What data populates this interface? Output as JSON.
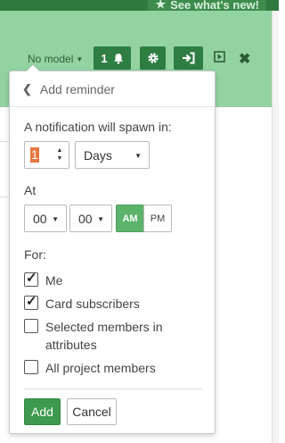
{
  "top_bar": {
    "whats_new_label": "See what's new!",
    "whats_new_icon": "star-icon"
  },
  "header": {
    "model_select_label": "No model",
    "notification_count": "1",
    "bell_icon": "bell-icon",
    "gear_icon": "gear-icon",
    "login_icon": "login-icon",
    "play_icon": "play-icon",
    "close_icon": "close-icon",
    "colors": {
      "header_bg": "#93d3a2",
      "button_bg": "#2e7d42",
      "accent": "#3d9a4e"
    }
  },
  "popup": {
    "title": "Add reminder",
    "spawn_label": "A notification will spawn in:",
    "amount_value": "1",
    "unit_value": "Days",
    "at_label": "At",
    "hour_value": "00",
    "minute_value": "00",
    "am_label": "AM",
    "pm_label": "PM",
    "selected_period": "AM",
    "for_label": "For:",
    "recipients": [
      {
        "label": "Me",
        "checked": true
      },
      {
        "label": "Card subscribers",
        "checked": true
      },
      {
        "label": "Selected members in attributes",
        "checked": false
      },
      {
        "label": "All project members",
        "checked": false
      }
    ],
    "add_button": "Add",
    "cancel_button": "Cancel"
  }
}
